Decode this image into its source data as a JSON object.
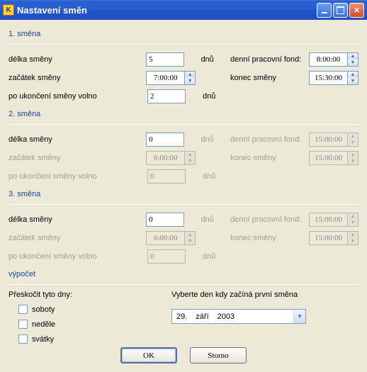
{
  "window": {
    "title": "Nastavení směn"
  },
  "units": {
    "days": "dnů"
  },
  "s1": {
    "title": "1. směna",
    "len_label": "délka směny",
    "len_value": "5",
    "start_label": "začátek směny",
    "start_value": "7:00:00",
    "off_label": "po ukončení směny volno",
    "off_value": "2",
    "fund_label": "denní pracovní fond:",
    "fund_value": "8:00:00",
    "end_label": "konec směny",
    "end_value": "15:30:00"
  },
  "s2": {
    "title": "2. směna",
    "len_label": "délka směny",
    "len_value": "0",
    "start_label": "začátek směny",
    "start_value": "6:00:00",
    "off_label": "po ukončení směny volno",
    "off_value": "0",
    "fund_label": "denní pracovní fond:",
    "fund_value": "15:00:00",
    "end_label": "konec směny",
    "end_value": "15:00:00"
  },
  "s3": {
    "title": "3. směna",
    "len_label": "délka směny",
    "len_value": "0",
    "start_label": "začátek směny",
    "start_value": "6:00:00",
    "off_label": "po ukončení směny volno",
    "off_value": "0",
    "fund_label": "denní pracovní fond:",
    "fund_value": "15:00:00",
    "end_label": "konec směny",
    "end_value": "15:00:00"
  },
  "calc": {
    "title": "výpočet",
    "skip_label": "Přeskočit tyto dny:",
    "saturdays": "soboty",
    "sundays": "neděle",
    "holidays": "svátky",
    "pick_label": "Vyberte den kdy začíná první směna",
    "date_day": "29.",
    "date_month": "září",
    "date_year": "2003"
  },
  "buttons": {
    "ok": "OK",
    "cancel": "Storno"
  }
}
